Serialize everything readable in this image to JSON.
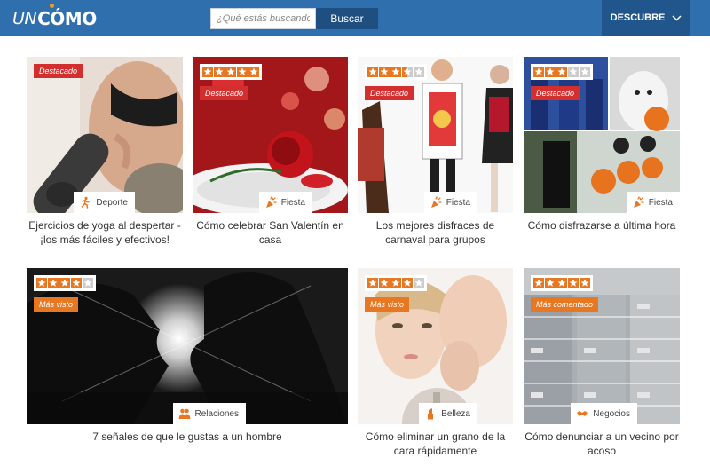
{
  "header": {
    "logo_un": "UN",
    "logo_como": "CÓMO",
    "search_placeholder": "¿Qué estás buscando?",
    "search_button": "Buscar",
    "discover_label": "DESCUBRE"
  },
  "colors": {
    "header": "#2f6fad",
    "accent": "#e87722",
    "star_on": "#e87722",
    "star_off": "#cccccc",
    "badge_red": "#d32f2f"
  },
  "cards": [
    {
      "title": "Ejercicios de yoga al despertar - ¡los más fáciles y efectivos!",
      "category": "Deporte",
      "category_icon": "running-person-icon",
      "badge": "Destacado",
      "rating": null
    },
    {
      "title": "Cómo celebrar San Valentín en casa",
      "category": "Fiesta",
      "category_icon": "party-popper-icon",
      "badge": "Destacado",
      "rating": 5
    },
    {
      "title": "Los mejores disfraces de carnaval para grupos",
      "category": "Fiesta",
      "category_icon": "party-popper-icon",
      "badge": "Destacado",
      "rating": 3.5
    },
    {
      "title": "Cómo disfrazarse a última hora",
      "category": "Fiesta",
      "category_icon": "party-popper-icon",
      "badge": "Destacado",
      "rating": 3
    },
    {
      "title": "7 señales de que le gustas a un hombre",
      "category": "Relaciones",
      "category_icon": "people-icon",
      "badge": "Más visto",
      "rating": 4
    },
    {
      "title": "Cómo eliminar un grano de la cara rápidamente",
      "category": "Belleza",
      "category_icon": "lipstick-icon",
      "badge": "Más visto",
      "rating": 4
    },
    {
      "title": "Cómo denunciar a un vecino por acoso",
      "category": "Negocios",
      "category_icon": "handshake-icon",
      "badge": "Más comentado",
      "rating": 5
    }
  ]
}
